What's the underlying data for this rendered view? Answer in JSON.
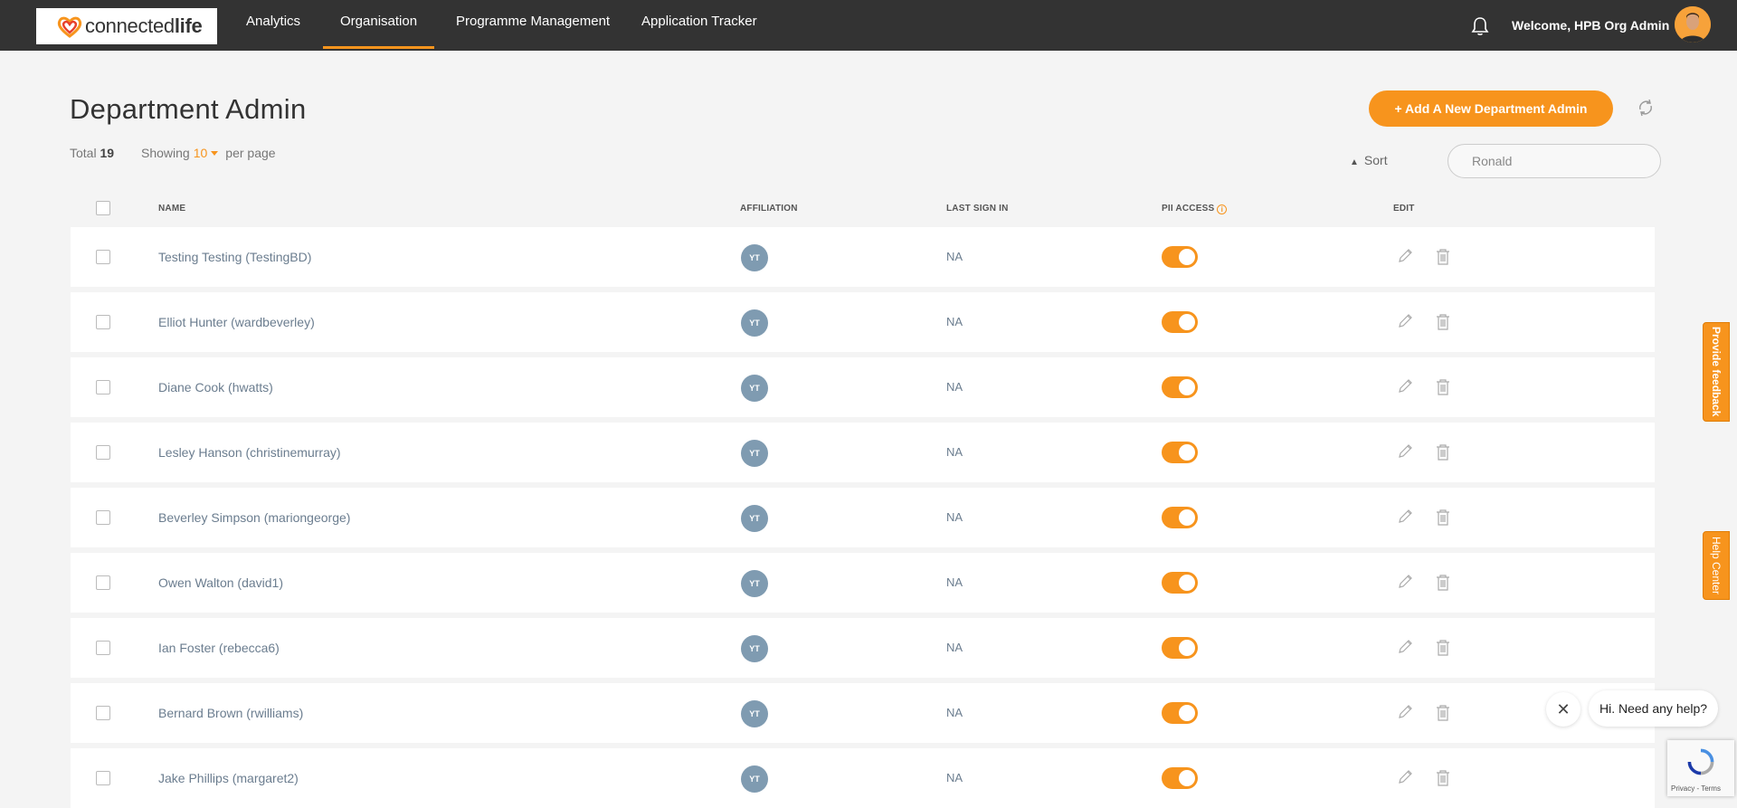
{
  "header": {
    "logo": {
      "text_light": "connected",
      "text_bold": "life"
    },
    "nav": [
      {
        "label": "Analytics",
        "active": false
      },
      {
        "label": "Organisation",
        "active": true
      },
      {
        "label": "Programme Management",
        "active": false
      },
      {
        "label": "Application Tracker",
        "active": false
      }
    ],
    "welcome": "Welcome, HPB Org Admin",
    "icons": {
      "notifications": "bell-icon",
      "avatar": "user-avatar"
    }
  },
  "page": {
    "title": "Department Admin",
    "add_button": "+ Add A New Department Admin",
    "total_label": "Total",
    "total_value": "19",
    "showing_label": "Showing",
    "per_page_value": "10",
    "per_page_suffix": "per page",
    "sort_label": "Sort",
    "search_value": "Ronald"
  },
  "table": {
    "columns": [
      "NAME",
      "AFFILIATION",
      "LAST SIGN IN",
      "PII ACCESS",
      "EDIT"
    ],
    "rows": [
      {
        "name": "Testing Testing (TestingBD)",
        "affiliation": "YT",
        "last_sign_in": "NA",
        "pii_access": true
      },
      {
        "name": "Elliot Hunter (wardbeverley)",
        "affiliation": "YT",
        "last_sign_in": "NA",
        "pii_access": true
      },
      {
        "name": "Diane Cook (hwatts)",
        "affiliation": "YT",
        "last_sign_in": "NA",
        "pii_access": true
      },
      {
        "name": "Lesley Hanson (christinemurray)",
        "affiliation": "YT",
        "last_sign_in": "NA",
        "pii_access": true
      },
      {
        "name": "Beverley Simpson (mariongeorge)",
        "affiliation": "YT",
        "last_sign_in": "NA",
        "pii_access": true
      },
      {
        "name": "Owen Walton (david1)",
        "affiliation": "YT",
        "last_sign_in": "NA",
        "pii_access": true
      },
      {
        "name": "Ian Foster (rebecca6)",
        "affiliation": "YT",
        "last_sign_in": "NA",
        "pii_access": true
      },
      {
        "name": "Bernard Brown (rwilliams)",
        "affiliation": "YT",
        "last_sign_in": "NA",
        "pii_access": true
      },
      {
        "name": "Jake Phillips (margaret2)",
        "affiliation": "YT",
        "last_sign_in": "NA",
        "pii_access": true
      }
    ]
  },
  "side_tabs": {
    "feedback": "Provide feedback",
    "help": "Help Center"
  },
  "chat": {
    "message": "Hi. Need any help?"
  },
  "recaptcha": {
    "text": "Privacy - Terms"
  },
  "colors": {
    "accent": "#f7941d",
    "topbar": "#333333",
    "affiliation": "#7f9bb1"
  }
}
